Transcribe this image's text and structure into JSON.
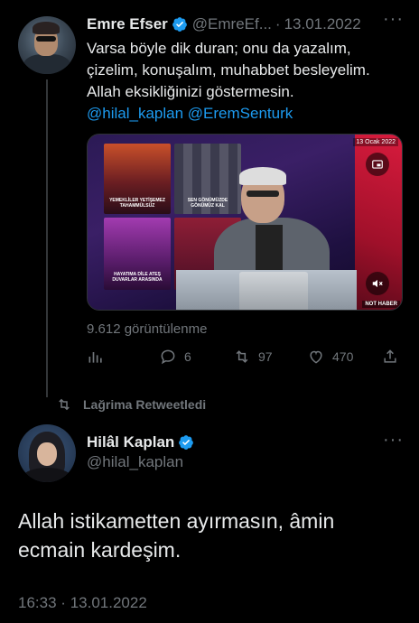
{
  "colors": {
    "background": "#000000",
    "text": "#e7e9ea",
    "muted": "#71767b",
    "link": "#1d9bf0",
    "verified": "#1d9bf0"
  },
  "quoted_tweet": {
    "author_name": "Emre Efser",
    "author_handle": "@EmreEf...",
    "separator": "·",
    "date": "13.01.2022",
    "more_icon": "more-dots-icon",
    "text_lines": [
      "Varsa böyle dik duran; onu da yazalım,",
      "çizelim, konuşalım, muhabbet besleyelim.",
      "Allah eksikliğinizi göstermesin."
    ],
    "mentions": [
      "@hilal_kaplan",
      "@EremSenturk"
    ],
    "media": {
      "date_badge": "13 Ocak 2022",
      "channel_logo": "NOT HABER",
      "screen_captions": [
        "YEMEKLİLER YETİŞEMEZ TAHAMMÜLSÜZ",
        "SEN GÖNÜMÜZDE GÖNÜMÜZ KAL",
        "HAYATIMA DİLE ATEŞ DUVARLAR ARASINDA"
      ],
      "pip_icon": "picture-in-picture-icon",
      "mute_icon": "volume-mute-icon"
    },
    "views": "9.612 görüntülenme",
    "actions": {
      "analytics": {
        "icon": "analytics-icon",
        "count": ""
      },
      "reply": {
        "icon": "reply-icon",
        "count": "6"
      },
      "retweet": {
        "icon": "retweet-icon",
        "count": "97"
      },
      "like": {
        "icon": "heart-icon",
        "count": "470"
      },
      "share": {
        "icon": "share-icon",
        "count": ""
      }
    }
  },
  "retweet_label": {
    "icon": "retweet-icon",
    "text": "Lağrima Retweetledi"
  },
  "main_tweet": {
    "author_name": "Hilâl Kaplan",
    "author_handle": "@hilal_kaplan",
    "more_icon": "more-dots-icon",
    "text_lines": [
      "Allah istikametten ayırmasın, âmin",
      "ecmain kardeşim."
    ],
    "time": "16:33",
    "separator": "·",
    "date": "13.01.2022"
  }
}
